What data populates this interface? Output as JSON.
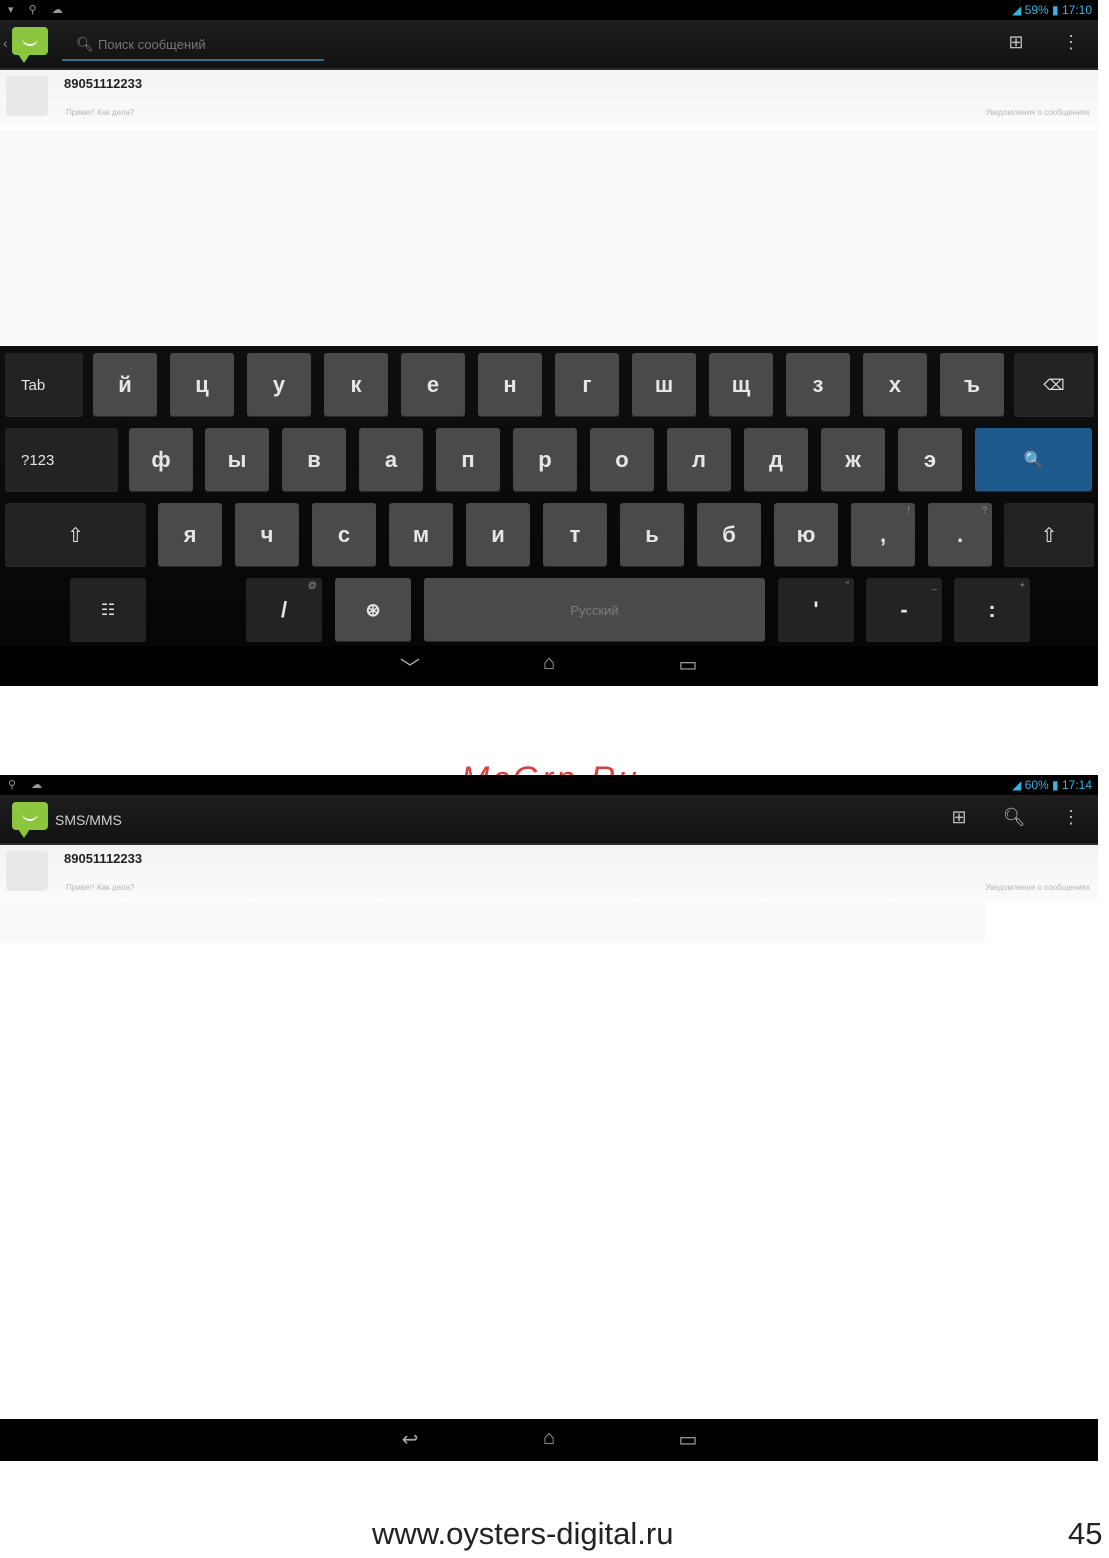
{
  "screen1": {
    "status": {
      "left_icons": "▾ ⚲ ☁",
      "battery": "59%",
      "time": "17:10"
    },
    "search_placeholder": "Поиск сообщений",
    "conversation": {
      "number": "89051112233",
      "snippet": "Привет! Как дела?",
      "meta": "Уведомления о сообщениях"
    },
    "keyboard": {
      "row1": [
        "Tab",
        "й",
        "ц",
        "у",
        "к",
        "е",
        "н",
        "г",
        "ш",
        "щ",
        "з",
        "х",
        "ъ",
        "⌫"
      ],
      "row2": [
        "?123",
        "ф",
        "ы",
        "в",
        "а",
        "п",
        "р",
        "о",
        "л",
        "д",
        "ж",
        "э",
        "🔍"
      ],
      "row3": [
        "⇧",
        "я",
        "ч",
        "с",
        "м",
        "и",
        "т",
        "ь",
        "б",
        "ю",
        ",",
        ".",
        "⇧"
      ],
      "row3_hints": {
        "comma": "!",
        "period": "?"
      },
      "row4": [
        "☷",
        "/",
        "⊛",
        "Русский",
        "'",
        "-",
        ":"
      ],
      "row4_hints": {
        "slash": "@",
        "apos": "\"",
        "dash": "_",
        "colon": "+"
      }
    },
    "nav": {
      "back": "﹀",
      "home": "⌂",
      "recents": "▭"
    }
  },
  "watermark": "McGrp.Ru",
  "screen2": {
    "status": {
      "left_icons": "⚲ ☁",
      "battery": "60%",
      "time": "17:14"
    },
    "title": "SMS/MMS",
    "conversation": {
      "number": "89051112233",
      "snippet": "Привет! Как дела?",
      "meta": "Уведомления о сообщениях"
    },
    "nav": {
      "back": "↩",
      "home": "⌂",
      "recents": "▭"
    }
  },
  "footer": {
    "url": "www.oysters-digital.ru",
    "page": "45"
  }
}
